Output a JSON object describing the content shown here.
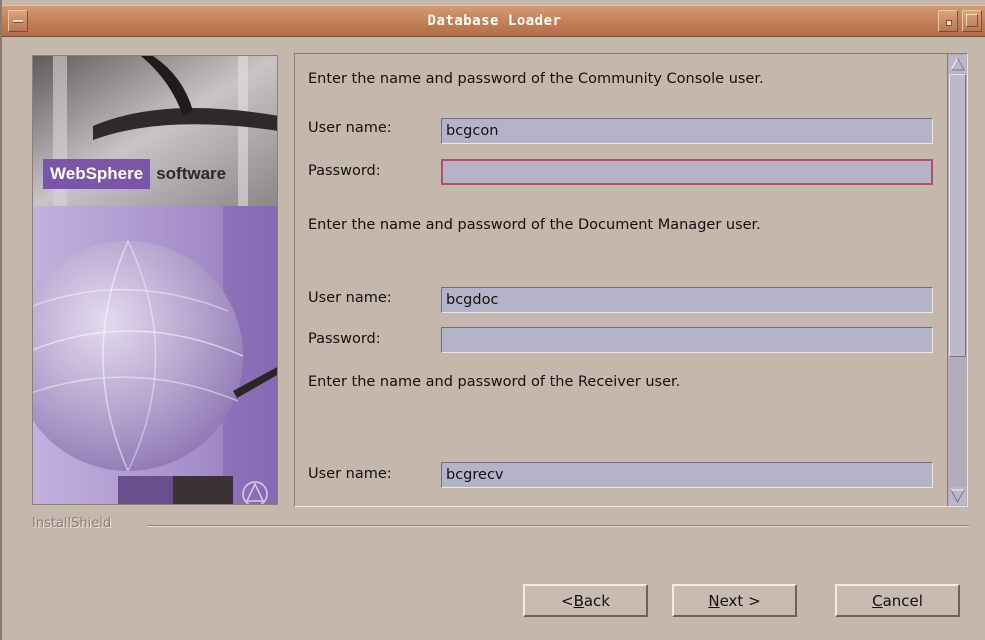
{
  "window": {
    "title": "Database Loader"
  },
  "banner": {
    "brand": "WebSphere",
    "brand_suffix": "software"
  },
  "form": {
    "console": {
      "instruction": "Enter the name and password of the Community Console user.",
      "user_label": "User name:",
      "user_value": "bcgcon",
      "password_label": "Password:",
      "password_value": ""
    },
    "docmgr": {
      "instruction": "Enter the name and password of the Document Manager user.",
      "user_label": "User name:",
      "user_value": "bcgdoc",
      "password_label": "Password:",
      "password_value": ""
    },
    "receiver": {
      "instruction": "Enter the name and password of the Receiver user.",
      "user_label": "User name:",
      "user_value": "bcgrecv"
    }
  },
  "footer": {
    "vendor": "InstallShield"
  },
  "buttons": {
    "back": {
      "accel": "B",
      "pre": "< ",
      "rest": "ack"
    },
    "next": {
      "accel": "N",
      "pre": "",
      "rest": "ext >"
    },
    "cancel": {
      "accel": "C",
      "pre": "",
      "rest": "ancel"
    }
  }
}
